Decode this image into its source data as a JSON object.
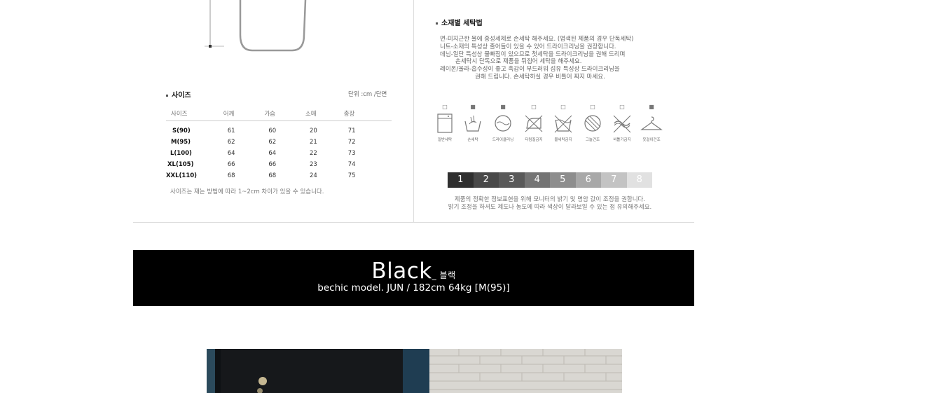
{
  "size_section": {
    "title": "사이즈",
    "unit": "단위 :cm /단면",
    "columns": [
      "사이즈",
      "어깨",
      "가슴",
      "소매",
      "총장"
    ],
    "rows": [
      {
        "size": "S(90)",
        "shoulder": "61",
        "chest": "60",
        "sleeve": "20",
        "length": "71"
      },
      {
        "size": "M(95)",
        "shoulder": "62",
        "chest": "62",
        "sleeve": "21",
        "length": "72"
      },
      {
        "size": "L(100)",
        "shoulder": "64",
        "chest": "64",
        "sleeve": "22",
        "length": "73"
      },
      {
        "size": "XL(105)",
        "shoulder": "66",
        "chest": "66",
        "sleeve": "23",
        "length": "74"
      },
      {
        "size": "XXL(110)",
        "shoulder": "68",
        "chest": "68",
        "sleeve": "24",
        "length": "75"
      }
    ],
    "note": "사이즈는 재는 방법에 따라 1~2cm 차이가 있을 수 있습니다."
  },
  "wash_section": {
    "title": "소재별 세탁법",
    "lines": [
      "면-미지근한 물에 중성세제로 손세탁 해주세요. (염색된 제품의 경우 단독세탁)",
      "니트-소재의 특성상 줄어들이 있을 수 있어 드라이크리닝을 권장합니다.",
      "데님-일단 특성상 물빠짐이 있으므로 첫세탁을 드라이크리닝을 권해 드리며",
      "손세탁시 단독으로 제품을 뒤집어 세탁을 해주세요.",
      "레이온/울라-흡수성이 좋고 촉감이 부드러워 섬유 특성상 드라이크리닝을",
      "권해 드립니다. 손세탁하실 경우 비틀어 짜지 마세요."
    ],
    "care_icons": [
      {
        "label": "일반세탁",
        "icon": "washing-machine-icon",
        "selected": false
      },
      {
        "label": "손세탁",
        "icon": "hand-wash-icon",
        "selected": true
      },
      {
        "label": "드라이클리닝",
        "icon": "dry-clean-icon",
        "selected": true
      },
      {
        "label": "다림질금지",
        "icon": "no-iron-icon",
        "selected": false
      },
      {
        "label": "물세탁금지",
        "icon": "no-water-wash-icon",
        "selected": false
      },
      {
        "label": "그늘건조",
        "icon": "shade-dry-icon",
        "selected": false
      },
      {
        "label": "비틀기금지",
        "icon": "no-wring-icon",
        "selected": false
      },
      {
        "label": "옷걸이건조",
        "icon": "hanger-dry-icon",
        "selected": true
      }
    ],
    "mark_on": "■",
    "mark_off": "□",
    "shade_scale": [
      {
        "label": "1",
        "color": "#0b0b0b"
      },
      {
        "label": "2",
        "color": "#2a2a2a"
      },
      {
        "label": "3",
        "color": "#3d3d3d"
      },
      {
        "label": "4",
        "color": "#5c5c5c"
      },
      {
        "label": "5",
        "color": "#7a7a7a"
      },
      {
        "label": "6",
        "color": "#9a9a9a"
      },
      {
        "label": "7",
        "color": "#b9b9b9"
      },
      {
        "label": "8",
        "color": "#dcdcdc"
      }
    ],
    "notice_lines": [
      "제품의 정확한 정보표현을 위해 모니터의 밝기 및 명암 값이 조정을 권합니다.",
      "밝기 조정을 하셔도 제도나 농도에 따라 색상이 달라보일 수 있는 점 유의해주세요."
    ]
  },
  "banner": {
    "title": "Black",
    "title_ko": "_ 블랙",
    "subtitle": "bechic model. JUN / 182cm 64kg [M(95)]"
  }
}
